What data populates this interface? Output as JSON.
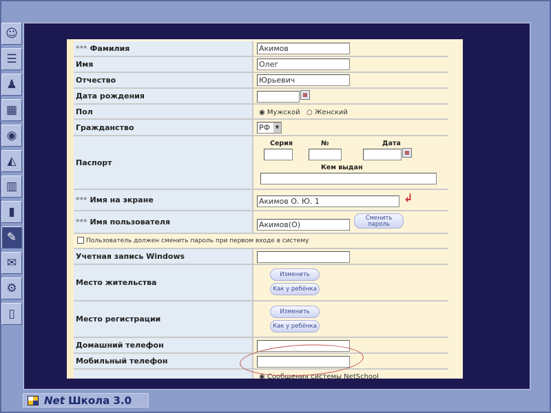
{
  "sidebar": {
    "icons": [
      "teacher-icon",
      "document-icon",
      "class-icon",
      "schedule-icon",
      "disc-icon",
      "bell-icon",
      "journal-icon",
      "reports-icon",
      "notes-icon",
      "mailbox-icon",
      "settings-icon",
      "exit-door-icon"
    ]
  },
  "form": {
    "surname": {
      "label": "Фамилия",
      "mark": "***",
      "value": "Акимов"
    },
    "name": {
      "label": "Имя",
      "value": "Олег"
    },
    "patronymic": {
      "label": "Отчество",
      "value": "Юрьевич"
    },
    "birthdate": {
      "label": "Дата рождения",
      "value": ""
    },
    "gender": {
      "label": "Пол",
      "options": [
        "Мужской",
        "Женский"
      ],
      "selected": "Мужской"
    },
    "citizenship": {
      "label": "Гражданство",
      "value": "РФ"
    },
    "passport": {
      "label": "Паспорт",
      "series": "Серия",
      "number": "№",
      "date": "Дата",
      "issued_by": "Кем выдан"
    },
    "screen_name": {
      "label": "Имя на экране",
      "mark": "***",
      "value": "Акимов О. Ю. 1"
    },
    "username": {
      "label": "Имя пользователя",
      "mark": "***",
      "value": "Акимов(О)",
      "change_password": "Сменить пароль"
    },
    "must_change": {
      "label": "Пользователь должен сменить пароль при первом входе в систему",
      "checked": false
    },
    "windows": {
      "label": "Учетная запись Windows",
      "value": ""
    },
    "residence": {
      "label": "Место жительства",
      "edit": "Изменить",
      "as_child": "Как у ребёнка"
    },
    "registration": {
      "label": "Место регистрации",
      "edit": "Изменить",
      "as_child": "Как у ребёнка"
    },
    "home_phone": {
      "label": "Домашний телефон",
      "value": ""
    },
    "mobile_phone": {
      "label": "Мобильный телефон",
      "value": ""
    },
    "notify": {
      "option": "Сообщения системы NetSchool"
    }
  },
  "logo": {
    "net": "Net",
    "school": "Школа 3.0"
  }
}
